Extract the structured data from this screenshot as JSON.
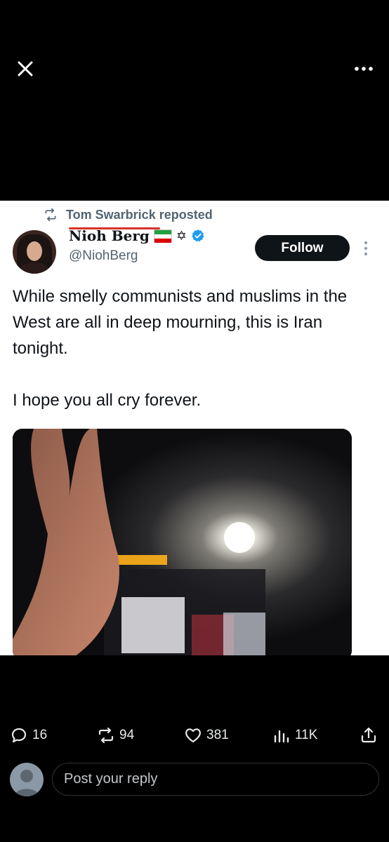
{
  "header": {
    "close_icon": "close-icon",
    "more_icon": "more-horizontal-icon"
  },
  "repost": {
    "icon": "repost-icon",
    "label": "Tom Swarbrick reposted"
  },
  "author": {
    "name": "Nioh Berg",
    "handle": "@NiohBerg",
    "flag_icon": "iran-lion-sun-flag-icon",
    "star_icon": "star-of-david-icon",
    "verified_icon": "verified-badge-icon",
    "verified_color": "#1d9bf0"
  },
  "follow_label": "Follow",
  "tweet": {
    "paragraph1": "While smelly communists and muslims in the West are all in deep mourning, this is Iran tonight.",
    "paragraph2": "I hope you all cry forever."
  },
  "actions": {
    "replies": "16",
    "reposts": "94",
    "likes": "381",
    "views": "11K"
  },
  "reply": {
    "placeholder": "Post your reply"
  },
  "colors": {
    "background": "#000000",
    "card": "#ffffff",
    "text_primary": "#0f1419",
    "text_secondary": "#536471",
    "flag_red_underline": "#d8322a"
  }
}
